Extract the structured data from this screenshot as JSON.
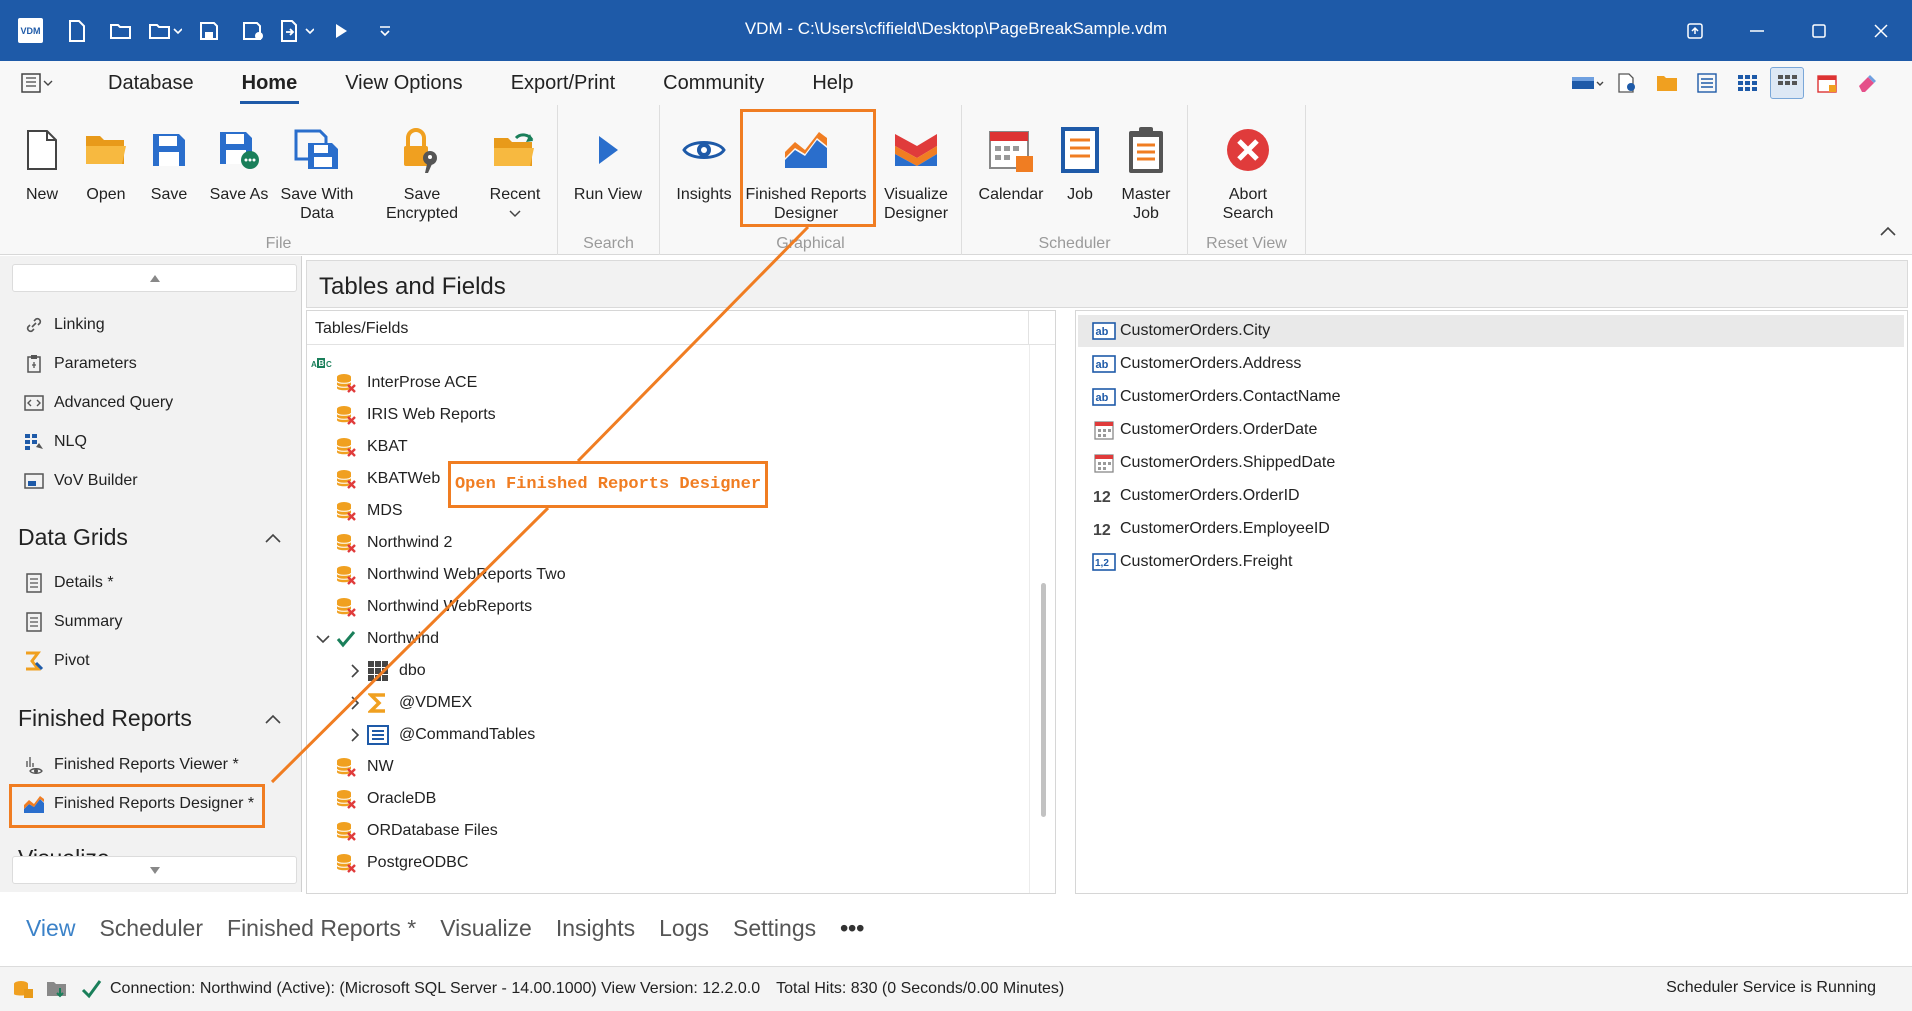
{
  "window": {
    "logo_text": "VDM",
    "title": "VDM - C:\\Users\\cfifield\\Desktop\\PageBreakSample.vdm"
  },
  "menu": {
    "tabs": [
      "Database",
      "Home",
      "View Options",
      "Export/Print",
      "Community",
      "Help"
    ],
    "active": "Home"
  },
  "ribbon": {
    "file": {
      "label": "File",
      "new": "New",
      "open": "Open",
      "save": "Save",
      "save_as": "Save As",
      "save_with_data": "Save With Data",
      "save_encrypted": "Save Encrypted",
      "recent": "Recent"
    },
    "search": {
      "label": "Search",
      "run_view": "Run View"
    },
    "graphical": {
      "label": "Graphical",
      "insights": "Insights",
      "finished_reports_designer": "Finished Reports Designer",
      "visualize_designer": "Visualize Designer"
    },
    "scheduler": {
      "label": "Scheduler",
      "calendar": "Calendar",
      "job": "Job",
      "master_job": "Master Job"
    },
    "reset_view": {
      "label": "Reset View",
      "abort_search": "Abort Search"
    }
  },
  "left_panel": {
    "items_top": [
      "Linking",
      "Parameters",
      "Advanced Query",
      "NLQ",
      "VoV Builder"
    ],
    "data_grids": {
      "title": "Data Grids",
      "items": [
        "Details *",
        "Summary",
        "Pivot"
      ]
    },
    "finished_reports": {
      "title": "Finished Reports",
      "items": [
        "Finished Reports Viewer *",
        "Finished Reports Designer *"
      ]
    },
    "next_section_partial": "Visualize"
  },
  "content": {
    "title": "Tables and Fields",
    "tree_header": "Tables/Fields",
    "abc_icon": "ABC",
    "tree_rows": [
      "InterProse ACE",
      "IRIS Web Reports",
      "KBAT",
      "KBATWeb",
      "MDS",
      "Northwind 2",
      "Northwind WebReports Two",
      "Northwind WebReports",
      "Northwind",
      "dbo",
      "@VDMEX",
      "@CommandTables",
      "NW",
      "OracleDB",
      "ORDatabase Files",
      "PostgreODBC"
    ],
    "fields": [
      {
        "name": "CustomerOrders.City",
        "icon": "text-field-icon",
        "glyph": "ab"
      },
      {
        "name": "CustomerOrders.Address",
        "icon": "text-field-icon",
        "glyph": "ab"
      },
      {
        "name": "CustomerOrders.ContactName",
        "icon": "text-field-icon",
        "glyph": "ab"
      },
      {
        "name": "CustomerOrders.OrderDate",
        "icon": "date-field-icon",
        "glyph": ""
      },
      {
        "name": "CustomerOrders.ShippedDate",
        "icon": "date-field-icon",
        "glyph": ""
      },
      {
        "name": "CustomerOrders.OrderID",
        "icon": "integer-field-icon",
        "glyph": "12"
      },
      {
        "name": "CustomerOrders.EmployeeID",
        "icon": "integer-field-icon",
        "glyph": "12"
      },
      {
        "name": "CustomerOrders.Freight",
        "icon": "decimal-field-icon",
        "glyph": "1,2"
      }
    ]
  },
  "bottom_tabs": [
    "View",
    "Scheduler",
    "Finished Reports *",
    "Visualize",
    "Insights",
    "Logs",
    "Settings",
    "•••"
  ],
  "status": {
    "connection": "Connection: Northwind (Active): (Microsoft SQL Server - 14.00.1000) View Version: 12.2.0.0",
    "hits": "Total Hits: 830 (0 Seconds/0.00 Minutes)",
    "scheduler": "Scheduler Service is Running"
  },
  "annotation": {
    "label": "Open Finished Reports Designer"
  },
  "colors": {
    "brand": "#1e5aa8",
    "accent": "#f07d22",
    "database_icon": "#f0a020",
    "error_red": "#e03b3b",
    "check_green": "#1a7f5a"
  }
}
